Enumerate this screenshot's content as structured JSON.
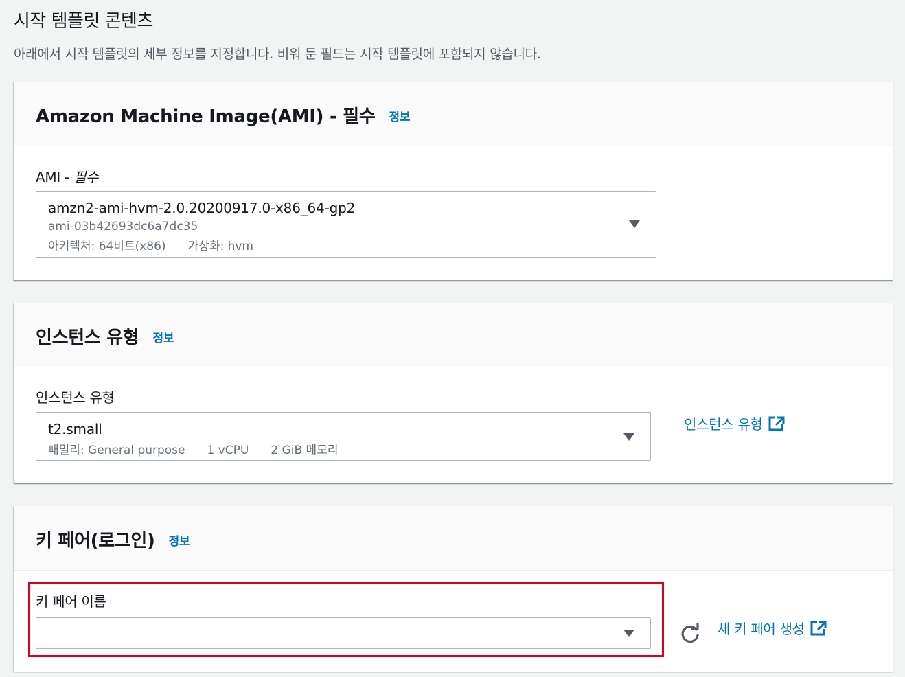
{
  "page": {
    "title": "시작 템플릿 콘텐츠",
    "description": "아래에서 시작 템플릿의 세부 정보를 지정합니다. 비워 둔 필드는 시작 템플릿에 포함되지 않습니다."
  },
  "ami_panel": {
    "title": "Amazon Machine Image(AMI) - 필수",
    "info_link": "정보",
    "field_label": "AMI - ",
    "field_label_required": "필수",
    "selected_name": "amzn2-ami-hvm-2.0.20200917.0-x86_64-gp2",
    "selected_id": "ami-03b42693dc6a7dc35",
    "architecture": "아키텍처: 64비트(x86)",
    "virtualization": "가상화: hvm"
  },
  "instance_panel": {
    "title": "인스턴스 유형",
    "info_link": "정보",
    "field_label": "인스턴스 유형",
    "selected_type": "t2.small",
    "family": "패밀리: General purpose",
    "vcpu": "1 vCPU",
    "memory": "2 GiB 메모리",
    "side_link": "인스턴스 유형"
  },
  "keypair_panel": {
    "title": "키 페어(로그인)",
    "info_link": "정보",
    "field_label": "키 페어 이름",
    "selected_value": "",
    "side_link": "새 키 페어 생성"
  },
  "colors": {
    "link": "#0073bb",
    "highlight": "#d9001b",
    "background": "#f2f3f3"
  },
  "icons": [
    "caret-down-icon",
    "external-link-icon",
    "refresh-icon"
  ]
}
